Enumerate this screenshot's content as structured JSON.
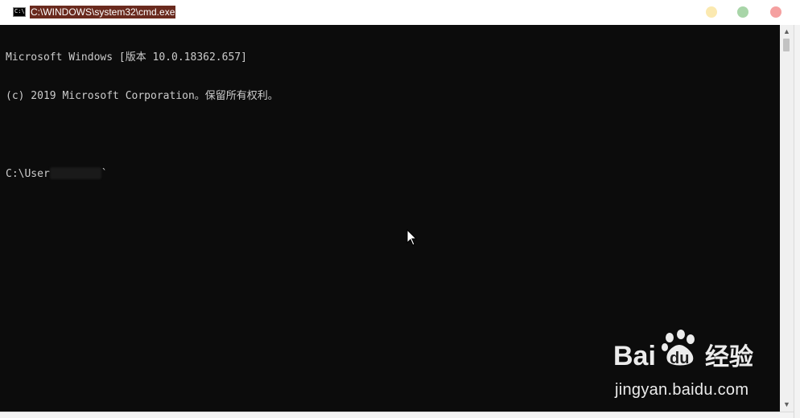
{
  "window": {
    "title": "C:\\WINDOWS\\system32\\cmd.exe",
    "icon": "cmd-icon",
    "controls": [
      "minimize-icon",
      "maximize-icon",
      "close-icon"
    ]
  },
  "console": {
    "lines": [
      "Microsoft Windows [版本 10.0.18362.657]",
      "(c) 2019 Microsoft Corporation。保留所有权利。",
      ""
    ],
    "prompt_prefix": "C:\\User",
    "prompt_suffix": "`",
    "background_color": "#0c0c0c",
    "text_color": "#cccccc"
  },
  "scrollbar": {
    "up_icon": "scroll-up-arrow-icon",
    "down_icon": "scroll-down-arrow-icon"
  },
  "watermark": {
    "logo_text": "Bai du 经验",
    "url": "jingyan.baidu.com"
  }
}
